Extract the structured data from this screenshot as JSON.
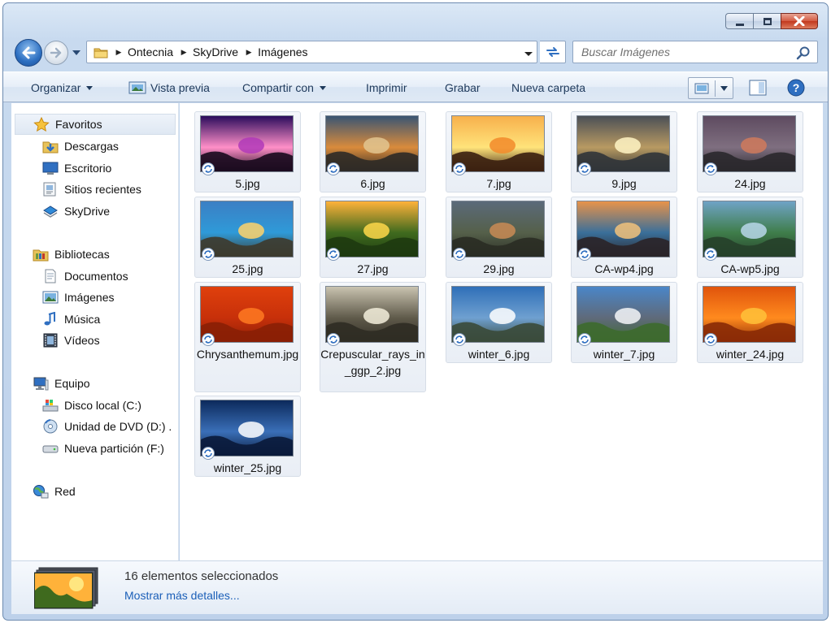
{
  "window": {
    "controls": [
      "minimize",
      "maximize",
      "close"
    ]
  },
  "address": {
    "crumbs": [
      "Ontecnia",
      "SkyDrive",
      "Imágenes"
    ]
  },
  "search": {
    "placeholder": "Buscar Imágenes"
  },
  "toolbar": {
    "organize": "Organizar",
    "preview": "Vista previa",
    "share": "Compartir con",
    "print": "Imprimir",
    "burn": "Grabar",
    "new_folder": "Nueva carpeta"
  },
  "sidebar": {
    "favorites": {
      "label": "Favoritos",
      "items": [
        "Descargas",
        "Escritorio",
        "Sitios recientes",
        "SkyDrive"
      ]
    },
    "libraries": {
      "label": "Bibliotecas",
      "items": [
        "Documentos",
        "Imágenes",
        "Música",
        "Vídeos"
      ]
    },
    "computer": {
      "label": "Equipo",
      "items": [
        "Disco local (C:)",
        "Unidad de DVD (D:) .",
        "Nueva partición (F:)"
      ]
    },
    "network": {
      "label": "Red"
    }
  },
  "files": [
    {
      "name": "5.jpg",
      "colors": [
        "#2a0c5c",
        "#b03ab8",
        "#ff8fc8",
        "#1a0a1e"
      ]
    },
    {
      "name": "6.jpg",
      "colors": [
        "#3a5573",
        "#e2c590",
        "#d98b3c",
        "#2d2a26"
      ]
    },
    {
      "name": "7.jpg",
      "colors": [
        "#f7b04c",
        "#f28a2a",
        "#ffe37a",
        "#3a1f10"
      ]
    },
    {
      "name": "9.jpg",
      "colors": [
        "#4b4f56",
        "#fff4c4",
        "#b89a62",
        "#303438"
      ]
    },
    {
      "name": "24.jpg",
      "colors": [
        "#5e4b60",
        "#d07a5c",
        "#7f6f80",
        "#2a282c"
      ]
    },
    {
      "name": "25.jpg",
      "colors": [
        "#3b7fc4",
        "#ffd26a",
        "#2f9ad8",
        "#3d3a2c"
      ]
    },
    {
      "name": "27.jpg",
      "colors": [
        "#ffb23a",
        "#ffd84a",
        "#3f6a1e",
        "#1e3a10"
      ]
    },
    {
      "name": "29.jpg",
      "colors": [
        "#5b6a7a",
        "#c98b55",
        "#55604a",
        "#2a2c24"
      ]
    },
    {
      "name": "CA-wp4.jpg",
      "colors": [
        "#e8934a",
        "#f3c27a",
        "#3a6f9a",
        "#2a2428"
      ]
    },
    {
      "name": "CA-wp5.jpg",
      "colors": [
        "#6fa3c6",
        "#b8d7ea",
        "#3f7d4a",
        "#26402a"
      ]
    },
    {
      "name": "Chrysanthemum.jpg",
      "colors": [
        "#e0400c",
        "#ff7a22",
        "#c7300a",
        "#8a1f06"
      ]
    },
    {
      "name": "Crepuscular_rays_in_ggp_2.jpg",
      "colors": [
        "#c9c3b0",
        "#f3efdc",
        "#5f5a4a",
        "#2f2c24"
      ]
    },
    {
      "name": "winter_6.jpg",
      "colors": [
        "#2f6fb8",
        "#ffffff",
        "#6fa0d0",
        "#3a4a3a"
      ]
    },
    {
      "name": "winter_7.jpg",
      "colors": [
        "#4a86c8",
        "#f4f6f8",
        "#5f6a7a",
        "#3d6a2e"
      ]
    },
    {
      "name": "winter_24.jpg",
      "colors": [
        "#e0540c",
        "#ffc23a",
        "#ff8a1e",
        "#8a2a06"
      ]
    },
    {
      "name": "winter_25.jpg",
      "colors": [
        "#0c2a5c",
        "#ffffff",
        "#3a6fb8",
        "#0a1a3a"
      ]
    }
  ],
  "details": {
    "count_text": "16 elementos seleccionados",
    "more_details": "Mostrar más detalles..."
  }
}
